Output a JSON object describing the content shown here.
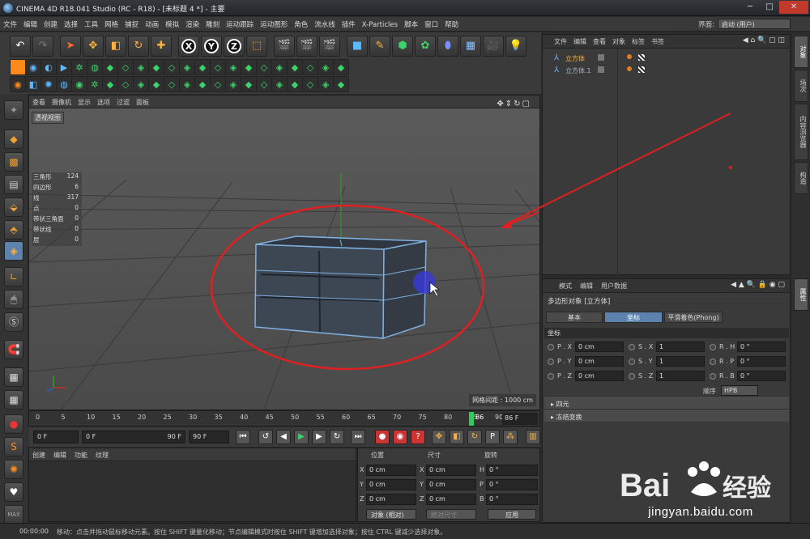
{
  "window": {
    "title": "CINEMA 4D R18.041 Studio (RC - R18) - [未标题 4 *] - 主要"
  },
  "menubar": {
    "items": [
      "文件",
      "编辑",
      "创建",
      "选择",
      "工具",
      "网格",
      "捕捉",
      "动画",
      "模拟",
      "渲染",
      "雕刻",
      "运动跟踪",
      "运动图形",
      "角色",
      "流水线",
      "插件",
      "X-Particles",
      "脚本",
      "窗口",
      "帮助"
    ],
    "interface_label": "界面:",
    "interface_value": "启动 (用户)"
  },
  "toolbar": {
    "axis_x": "X",
    "axis_y": "Y",
    "axis_z": "Z"
  },
  "viewport": {
    "menu": [
      "查看",
      "摄像机",
      "显示",
      "选项",
      "过滤",
      "面板"
    ],
    "view_label": "透视视图",
    "stats": [
      {
        "label": "三角形",
        "value": "124"
      },
      {
        "label": "四边形",
        "value": "6"
      },
      {
        "label": "线",
        "value": "317"
      },
      {
        "label": "点",
        "value": "0"
      },
      {
        "label": "带状三角面",
        "value": "0"
      },
      {
        "label": "带状线",
        "value": "0"
      },
      {
        "label": "层",
        "value": "0"
      }
    ],
    "grid_spacing": "网格间距 : 1000 cm"
  },
  "timeline": {
    "ticks": [
      "0",
      "5",
      "10",
      "15",
      "20",
      "25",
      "30",
      "35",
      "40",
      "45",
      "50",
      "55",
      "60",
      "65",
      "70",
      "75",
      "80",
      "85",
      "90"
    ],
    "playhead_label": "86",
    "current_frame": "86 F"
  },
  "transport": {
    "start": "0 F",
    "range_start": "0 F",
    "range_end": "90 F",
    "end": "90 F"
  },
  "material_panel": {
    "menu": [
      "创建",
      "编辑",
      "功能",
      "纹理"
    ]
  },
  "coord_panel": {
    "headers": [
      "位置",
      "尺寸",
      "旋转"
    ],
    "rows": [
      {
        "axis": "X",
        "pos": "0 cm",
        "size_axis": "X",
        "size": "0 cm",
        "rot_axis": "H",
        "rot": "0 °"
      },
      {
        "axis": "Y",
        "pos": "0 cm",
        "size_axis": "Y",
        "size": "0 cm",
        "rot_axis": "P",
        "rot": "0 °"
      },
      {
        "axis": "Z",
        "pos": "0 cm",
        "size_axis": "Z",
        "size": "0 cm",
        "rot_axis": "B",
        "rot": "0 °"
      }
    ],
    "mode": "对象 (相对)",
    "size_mode": "绝对尺寸",
    "apply": "应用"
  },
  "object_manager": {
    "menu": [
      "文件",
      "编辑",
      "查看",
      "对象",
      "标签",
      "书签"
    ],
    "objects": [
      {
        "name": "立方体",
        "selected": true
      },
      {
        "name": "立方体.1",
        "selected": false
      }
    ]
  },
  "attr_manager": {
    "menu": [
      "模式",
      "编辑",
      "用户数据"
    ],
    "object_title": "多边形对象 [立方体]",
    "tabs": [
      {
        "label": "基本",
        "active": false
      },
      {
        "label": "坐标",
        "active": true
      },
      {
        "label": "平滑着色(Phong)",
        "active": false
      }
    ],
    "section": "坐标",
    "props": [
      {
        "p_label": "P . X",
        "p_val": "0 cm",
        "s_label": "S . X",
        "s_val": "1",
        "r_label": "R . H",
        "r_val": "0 °"
      },
      {
        "p_label": "P . Y",
        "p_val": "0 cm",
        "s_label": "S . Y",
        "s_val": "1",
        "r_label": "R . P",
        "r_val": "0 °"
      },
      {
        "p_label": "P . Z",
        "p_val": "0 cm",
        "s_label": "S . Z",
        "s_val": "1",
        "r_label": "R . B",
        "r_val": "0 °"
      }
    ],
    "order_label": "顺序",
    "order_value": "HPB",
    "collapse_1": "▸ 四元",
    "collapse_2": "▸ 冻结变换"
  },
  "right_tabs": [
    "对象",
    "场次",
    "内容浏览器",
    "构造",
    "属性"
  ],
  "status": {
    "time": "00:00:00",
    "message": "移动：点击并拖动鼠标移动元素。按住 SHIFT 键量化移动；节点编辑模式时按住 SHIFT 键增加选择对象；按住 CTRL 键减少选择对象。"
  },
  "watermark": {
    "url": "jingyan.baidu.com"
  },
  "colors": {
    "accent": "#5c82ad",
    "annotation_red": "#e02020",
    "object_orange": "#ffb13b"
  }
}
